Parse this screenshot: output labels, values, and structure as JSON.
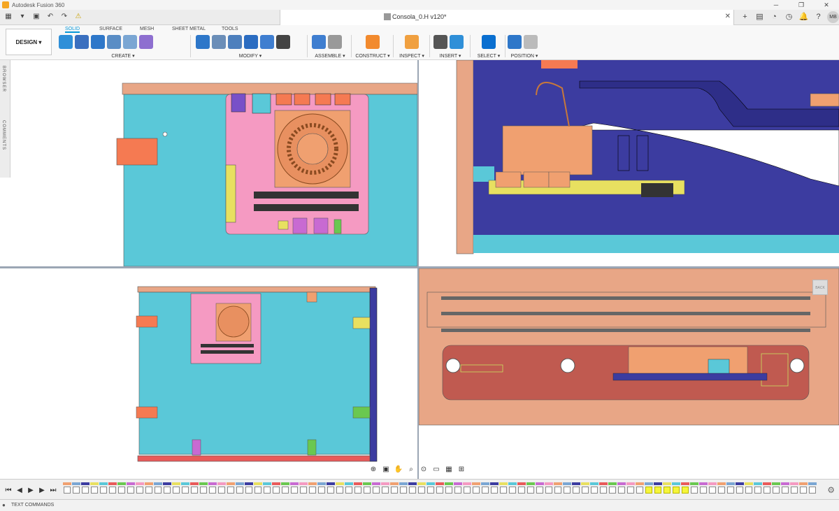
{
  "app": {
    "title": "Autodesk Fusion 360"
  },
  "window": {
    "minimize": "─",
    "restore": "❐",
    "close": "✕"
  },
  "document": {
    "tab_title": "Consola_0.H v120*",
    "close": "✕"
  },
  "quick_access": {
    "grid": "▦",
    "file": "▾",
    "save": "▣",
    "undo": "↶",
    "redo": "↷",
    "warn": "⚠"
  },
  "right_tools": {
    "add": "+",
    "chat": "▤",
    "update": "◔",
    "clock": "◷",
    "notif": "🔔",
    "help": "?",
    "user_initials": "MB"
  },
  "workspace": {
    "label": "DESIGN ▾"
  },
  "tabs": [
    "SOLID",
    "SURFACE",
    "MESH",
    "SHEET METAL",
    "TOOLS"
  ],
  "toolbar_groups": [
    {
      "label": "CREATE ▾",
      "count": 6
    },
    {
      "label": "MODIFY ▾",
      "count": 6
    },
    {
      "label": "ASSEMBLE ▾",
      "count": 2
    },
    {
      "label": "CONSTRUCT ▾",
      "count": 1
    },
    {
      "label": "INSPECT ▾",
      "count": 1
    },
    {
      "label": "INSERT ▾",
      "count": 2
    },
    {
      "label": "SELECT ▾",
      "count": 1
    },
    {
      "label": "POSITION ▾",
      "count": 2
    }
  ],
  "side_panels": {
    "browser": "BROWSER",
    "comments": "COMMENTS"
  },
  "viewcube": {
    "label": "BACK"
  },
  "navbar": {
    "orbit": "⊕",
    "look": "▣",
    "pan": "✋",
    "zoom": "⌕",
    "fit": "⊙",
    "display": "▭",
    "grid": "▦",
    "views": "⊞"
  },
  "timeline": {
    "controls": [
      "⏮",
      "◀",
      "▶",
      "▶",
      "⏭"
    ],
    "item_count": 83,
    "highlight_start": 64,
    "highlight_count": 5
  },
  "status": {
    "text": "TEXT COMMANDS"
  }
}
